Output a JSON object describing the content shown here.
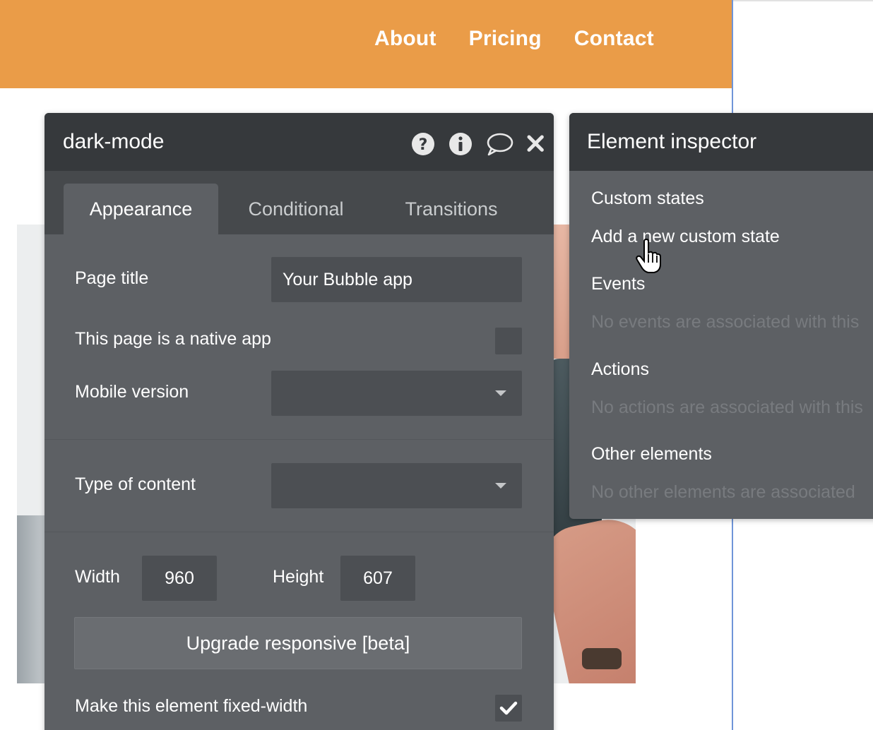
{
  "site": {
    "nav": [
      "About",
      "Pricing",
      "Contact"
    ],
    "header_color": "#ea9c48"
  },
  "property_editor": {
    "title": "dark-mode",
    "header_icons": [
      "help-icon",
      "info-icon",
      "comment-icon",
      "close-icon"
    ],
    "tabs": [
      {
        "label": "Appearance",
        "active": true
      },
      {
        "label": "Conditional",
        "active": false
      },
      {
        "label": "Transitions",
        "active": false
      }
    ],
    "page_title_label": "Page title",
    "page_title_value": "Your Bubble app",
    "native_app_label": "This page is a native app",
    "native_app_checked": false,
    "mobile_version_label": "Mobile version",
    "mobile_version_value": "",
    "type_of_content_label": "Type of content",
    "type_of_content_value": "",
    "width_label": "Width",
    "width_value": "960",
    "height_label": "Height",
    "height_value": "607",
    "upgrade_button": "Upgrade responsive [beta]",
    "fixed_width_label": "Make this element fixed-width",
    "fixed_width_checked": true
  },
  "element_inspector": {
    "title": "Element inspector",
    "custom_states_heading": "Custom states",
    "add_custom_state_link": "Add a new custom state",
    "events_heading": "Events",
    "events_empty": "No events are associated with this",
    "actions_heading": "Actions",
    "actions_empty": "No actions are associated with this",
    "other_elements_heading": "Other elements",
    "other_elements_empty": "No other elements are associated"
  },
  "colors": {
    "panel_bg": "#5d6064",
    "panel_header": "#36393c",
    "field_bg": "#4c4f53",
    "muted_text": "#787b7f",
    "page_border": "#6f95d8"
  }
}
